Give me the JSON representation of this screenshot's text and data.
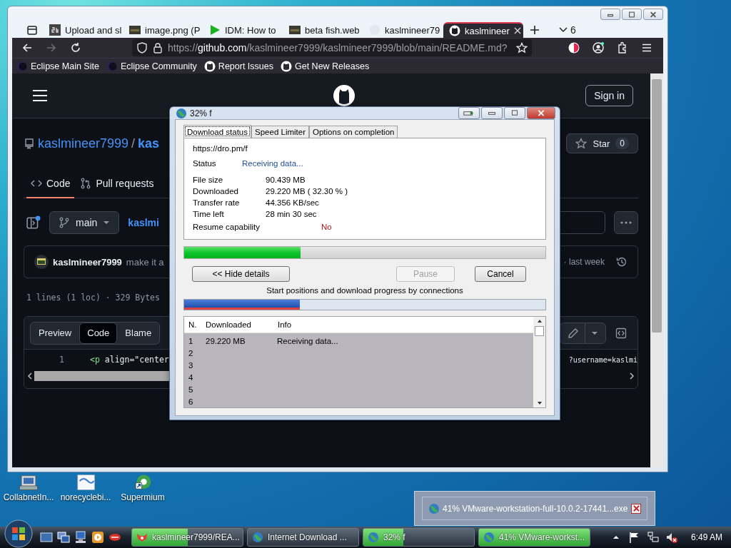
{
  "desktop_icons": [
    {
      "label": "CollabnetIn...",
      "kind": "installer"
    },
    {
      "label": "norecyclebi...",
      "kind": "document"
    },
    {
      "label": "Supermium",
      "kind": "shortcut"
    }
  ],
  "browser": {
    "tabs": [
      {
        "label": "Upload and sl",
        "kind": "sb",
        "selected": false
      },
      {
        "label": "image.png (P",
        "kind": "image",
        "selected": false
      },
      {
        "label": "IDM: How to",
        "kind": "play",
        "selected": false
      },
      {
        "label": "beta fish.web",
        "kind": "image",
        "selected": false
      },
      {
        "label": "kaslmineer79",
        "kind": "blank",
        "selected": false
      },
      {
        "label": "kaslmineer",
        "kind": "github",
        "selected": true
      }
    ],
    "tab_count": "6",
    "forward_disabled": true,
    "url": {
      "scheme": "https://",
      "host": "github.com",
      "path": "/kaslmineer7999/kaslmineer7999/blob/main/README.md?"
    },
    "bookmarks": [
      {
        "label": "Eclipse Main Site",
        "kind": "eclipse"
      },
      {
        "label": "Eclipse Community",
        "kind": "eclipse"
      },
      {
        "label": "Report Issues",
        "kind": "github"
      },
      {
        "label": "Get New Releases",
        "kind": "github"
      }
    ]
  },
  "github_page": {
    "sign_in": "Sign in",
    "owner": "kaslmineer7999",
    "separator": "/",
    "repo": "kas",
    "star_label": "Star",
    "star_count": "0",
    "nav_tabs": [
      {
        "label": "Code",
        "kind": "code",
        "selected": true
      },
      {
        "label": "Pull requests",
        "kind": "pull",
        "selected": false
      }
    ],
    "branch": "main",
    "path": "kaslmi",
    "commit": {
      "author": "kaslmineer7999",
      "message": "make it a",
      "time": "· last week"
    },
    "file_info": "1 lines (1 loc) · 329 Bytes",
    "view_modes": [
      {
        "label": "Preview",
        "selected": false
      },
      {
        "label": "Code",
        "selected": true
      },
      {
        "label": "Blame",
        "selected": false
      }
    ],
    "code_line": {
      "number": "1",
      "tokens": [
        {
          "text": "<p",
          "kind": "tag"
        },
        {
          "text": " align=\"center",
          "kind": "attr"
        }
      ],
      "end": "?username=kaslmi"
    }
  },
  "download_dialog": {
    "title": "32% f",
    "tabs": [
      {
        "label": "Download status",
        "selected": true
      },
      {
        "label": "Speed Limiter",
        "selected": false
      },
      {
        "label": "Options on completion",
        "selected": false
      }
    ],
    "url": "https://dro.pm/f",
    "details": [
      {
        "label": "Status",
        "value": "Receiving data...",
        "kind": "status"
      },
      {
        "label": "File size",
        "value": "90.439 MB",
        "kind": "stat"
      },
      {
        "label": "Downloaded",
        "value": "29.220 MB ( 32.30 % )",
        "kind": "stat"
      },
      {
        "label": "Transfer rate",
        "value": "44.356 KB/sec",
        "kind": "stat"
      },
      {
        "label": "Time left",
        "value": "28 min 30 sec",
        "kind": "stat"
      },
      {
        "label": "Resume capability",
        "value": "No",
        "kind": "resume"
      }
    ],
    "progress": {
      "level": 0.323
    },
    "buttons": [
      {
        "label": "<< Hide details",
        "disabled": false
      },
      {
        "label": "Pause",
        "disabled": true
      },
      {
        "label": "Cancel",
        "disabled": false
      }
    ],
    "connections_caption": "Start positions and download progress by connections",
    "connections_bar": {
      "level": 0.32
    },
    "table": {
      "columns": [
        "N.",
        "Downloaded",
        "Info"
      ],
      "rows": [
        {
          "n": "1",
          "downloaded": "29.220 MB",
          "info": "Receiving data..."
        },
        {
          "n": "2"
        },
        {
          "n": "3"
        },
        {
          "n": "4"
        },
        {
          "n": "5"
        },
        {
          "n": "6"
        }
      ]
    }
  },
  "notification": {
    "text": "41% VMware-workstation-full-10.0.2-17441...exe"
  },
  "taskbar": {
    "tasks": [
      {
        "label": "kaslmineer7999/REA...",
        "kind": "browser",
        "level": 0.5
      },
      {
        "label": "Internet Download ...",
        "kind": "idm"
      },
      {
        "label": "32% f",
        "kind": "idm",
        "level": 0.36
      },
      {
        "label": "41% VMware-workst...",
        "kind": "idm",
        "level": 1
      }
    ],
    "clock": "6:49 AM"
  }
}
